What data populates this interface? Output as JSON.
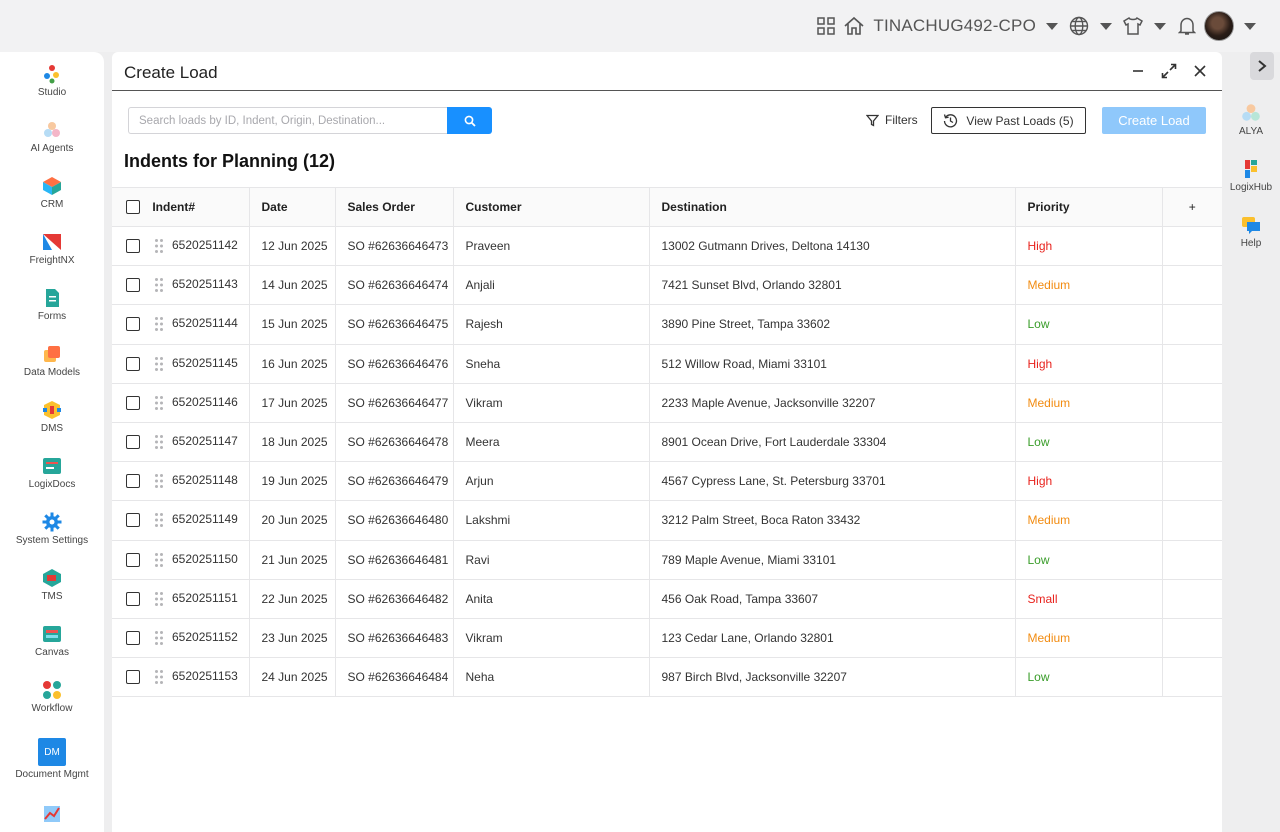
{
  "topbar": {
    "tenant": "TINACHUG492-CPO"
  },
  "sidebar": {
    "items": [
      {
        "label": "Studio",
        "icon": "studio-icon"
      },
      {
        "label": "AI Agents",
        "icon": "ai-agents-icon"
      },
      {
        "label": "CRM",
        "icon": "crm-icon"
      },
      {
        "label": "FreightNX",
        "icon": "freightnx-icon"
      },
      {
        "label": "Forms",
        "icon": "forms-icon"
      },
      {
        "label": "Data Models",
        "icon": "data-models-icon"
      },
      {
        "label": "DMS",
        "icon": "dms-icon"
      },
      {
        "label": "LogixDocs",
        "icon": "logixdocs-icon"
      },
      {
        "label": "System Settings",
        "icon": "gear-icon"
      },
      {
        "label": "TMS",
        "icon": "tms-icon"
      },
      {
        "label": "Canvas",
        "icon": "canvas-icon"
      },
      {
        "label": "Workflow",
        "icon": "workflow-icon"
      },
      {
        "label": "Document Mgmt",
        "icon": "document-mgmt-icon",
        "badge": "DM"
      }
    ]
  },
  "rail": {
    "items": [
      {
        "label": "ALYA"
      },
      {
        "label": "LogixHub"
      },
      {
        "label": "Help"
      }
    ]
  },
  "panel": {
    "title": "Create Load",
    "search_placeholder": "Search loads by ID, Indent, Origin, Destination...",
    "filters_label": "Filters",
    "past_loads_label": "View Past Loads (5)",
    "create_label": "Create Load",
    "section_title": "Indents for Planning (12)"
  },
  "table": {
    "columns": [
      "Indent#",
      "Date",
      "Sales Order",
      "Customer",
      "Destination",
      "Priority"
    ],
    "add_column": "+",
    "rows": [
      {
        "indent": "6520251142",
        "date": "12 Jun 2025",
        "so": "SO #62636646473",
        "customer": "Praveen",
        "destination": "13002 Gutmann Drives, Deltona 14130",
        "priority": "High"
      },
      {
        "indent": "6520251143",
        "date": "14 Jun 2025",
        "so": "SO #62636646474",
        "customer": "Anjali",
        "destination": "7421 Sunset Blvd, Orlando 32801",
        "priority": "Medium"
      },
      {
        "indent": "6520251144",
        "date": "15 Jun 2025",
        "so": "SO #62636646475",
        "customer": "Rajesh",
        "destination": "3890 Pine Street, Tampa 33602",
        "priority": "Low"
      },
      {
        "indent": "6520251145",
        "date": "16 Jun 2025",
        "so": "SO #62636646476",
        "customer": "Sneha",
        "destination": "512 Willow Road, Miami 33101",
        "priority": "High"
      },
      {
        "indent": "6520251146",
        "date": "17 Jun 2025",
        "so": "SO #62636646477",
        "customer": "Vikram",
        "destination": "2233 Maple Avenue, Jacksonville 32207",
        "priority": "Medium"
      },
      {
        "indent": "6520251147",
        "date": "18 Jun 2025",
        "so": "SO #62636646478",
        "customer": "Meera",
        "destination": "8901 Ocean Drive, Fort Lauderdale 33304",
        "priority": "Low"
      },
      {
        "indent": "6520251148",
        "date": "19 Jun 2025",
        "so": "SO #62636646479",
        "customer": "Arjun",
        "destination": "4567 Cypress Lane, St. Petersburg 33701",
        "priority": "High"
      },
      {
        "indent": "6520251149",
        "date": "20 Jun 2025",
        "so": "SO #62636646480",
        "customer": "Lakshmi",
        "destination": "3212 Palm Street, Boca Raton 33432",
        "priority": "Medium"
      },
      {
        "indent": "6520251150",
        "date": "21 Jun 2025",
        "so": "SO #62636646481",
        "customer": "Ravi",
        "destination": "789 Maple Avenue, Miami 33101",
        "priority": "Low"
      },
      {
        "indent": "6520251151",
        "date": "22 Jun 2025",
        "so": "SO #62636646482",
        "customer": "Anita",
        "destination": "456 Oak Road, Tampa 33607",
        "priority": "Small"
      },
      {
        "indent": "6520251152",
        "date": "23 Jun 2025",
        "so": "SO #62636646483",
        "customer": "Vikram",
        "destination": "123 Cedar Lane, Orlando 32801",
        "priority": "Medium"
      },
      {
        "indent": "6520251153",
        "date": "24 Jun 2025",
        "so": "SO #62636646484",
        "customer": "Neha",
        "destination": "987 Birch Blvd, Jacksonville 32207",
        "priority": "Low"
      }
    ]
  },
  "colors": {
    "accent": "#1890ff",
    "accent_disabled": "#8fc8fb",
    "priority_high": "#e8231e",
    "priority_medium": "#f28c12",
    "priority_low": "#3a9d2a",
    "priority_small": "#e8231e"
  }
}
